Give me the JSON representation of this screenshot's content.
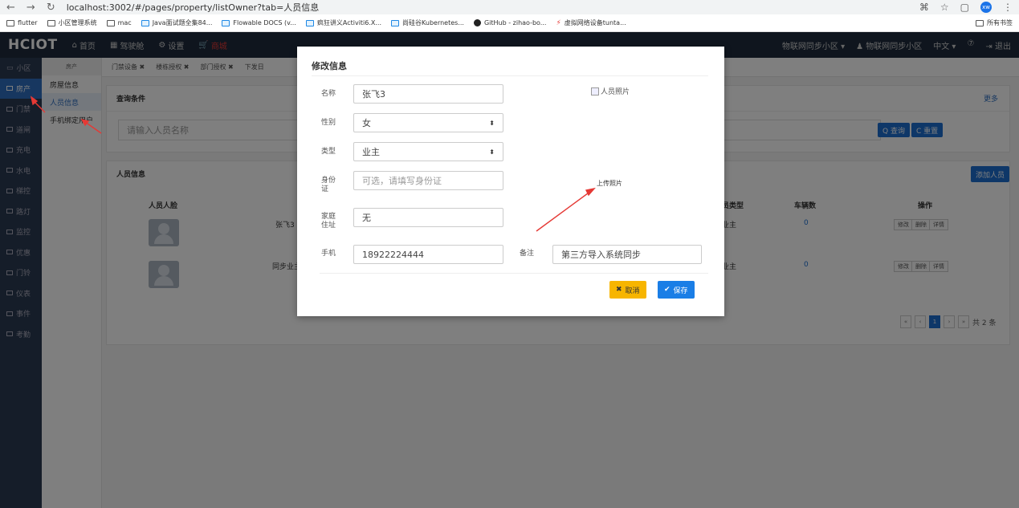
{
  "browser": {
    "url": "localhost:3002/#/pages/property/listOwner?tab=人员信息",
    "avatar": "xw",
    "bookmarks": [
      "flutter",
      "小区管理系统",
      "mac",
      "Java面试题全集84...",
      "Flowable DOCS (v...",
      "疯狂讲义Activiti6.X...",
      "尚硅谷Kubernetes...",
      "GitHub - zihao-bo...",
      "虚拟网络设备tunta..."
    ],
    "all_bookmarks": "所有书签"
  },
  "topnav": {
    "brand": "HCIOT",
    "items": [
      "首页",
      "驾驶舱",
      "设置",
      "商城"
    ],
    "right": [
      "物联网同步小区 ▾",
      "物联网同步小区",
      "中文 ▾",
      "⑦",
      "退出"
    ]
  },
  "sidebar": {
    "items": [
      "小区",
      "房产",
      "门禁",
      "道闸",
      "充电",
      "水电",
      "梯控",
      "路灯",
      "监控",
      "优惠",
      "门铃",
      "仪表",
      "事件",
      "考勤"
    ],
    "active_index": 1
  },
  "subnav": {
    "header": "房产",
    "items": [
      "房屋信息",
      "人员信息",
      "手机绑定用户"
    ],
    "active_index": 1
  },
  "tabs": [
    "门禁设备 ✖",
    "楼栋授权 ✖",
    "部门授权 ✖",
    "下发日"
  ],
  "query_panel": {
    "title": "查询条件",
    "more": "更多",
    "placeholder": "请输入人员名称",
    "query_btn": "Q 查询",
    "reset_btn": "C 重置"
  },
  "list_panel": {
    "title": "人员信息",
    "add_btn": "添加人员",
    "headers": [
      "人员人脸",
      "员类型",
      "车辆数",
      "操作"
    ],
    "rows": [
      {
        "name": "张飞3",
        "type": "业主",
        "cars": "0"
      },
      {
        "name": "同步业主",
        "type": "业主",
        "cars": "0"
      }
    ],
    "ops": [
      "修改",
      "删除",
      "详情"
    ],
    "pager": {
      "prev2": "«",
      "prev": "‹",
      "current": "1",
      "next": "›",
      "next2": "»",
      "total": "共 2 条"
    }
  },
  "modal": {
    "title": "修改信息",
    "fields": {
      "name": {
        "label": "名称",
        "value": "张飞3"
      },
      "gender": {
        "label": "性别",
        "value": "女"
      },
      "type": {
        "label": "类型",
        "value": "业主"
      },
      "idcard": {
        "label": "身份证",
        "placeholder": "可选，请填写身份证"
      },
      "address": {
        "label": "家庭住址",
        "value": "无"
      },
      "phone": {
        "label": "手机",
        "value": "18922224444"
      },
      "remark": {
        "label": "备注",
        "value": "第三方导入系统同步"
      }
    },
    "photo_alt": "人员照片",
    "upload": "上传照片",
    "cancel": "取消",
    "save": "保存"
  },
  "colors": {
    "primary": "#1a7ee6",
    "warning": "#f7b500",
    "nav": "#1e2b3c",
    "annotation": "#e53935"
  }
}
